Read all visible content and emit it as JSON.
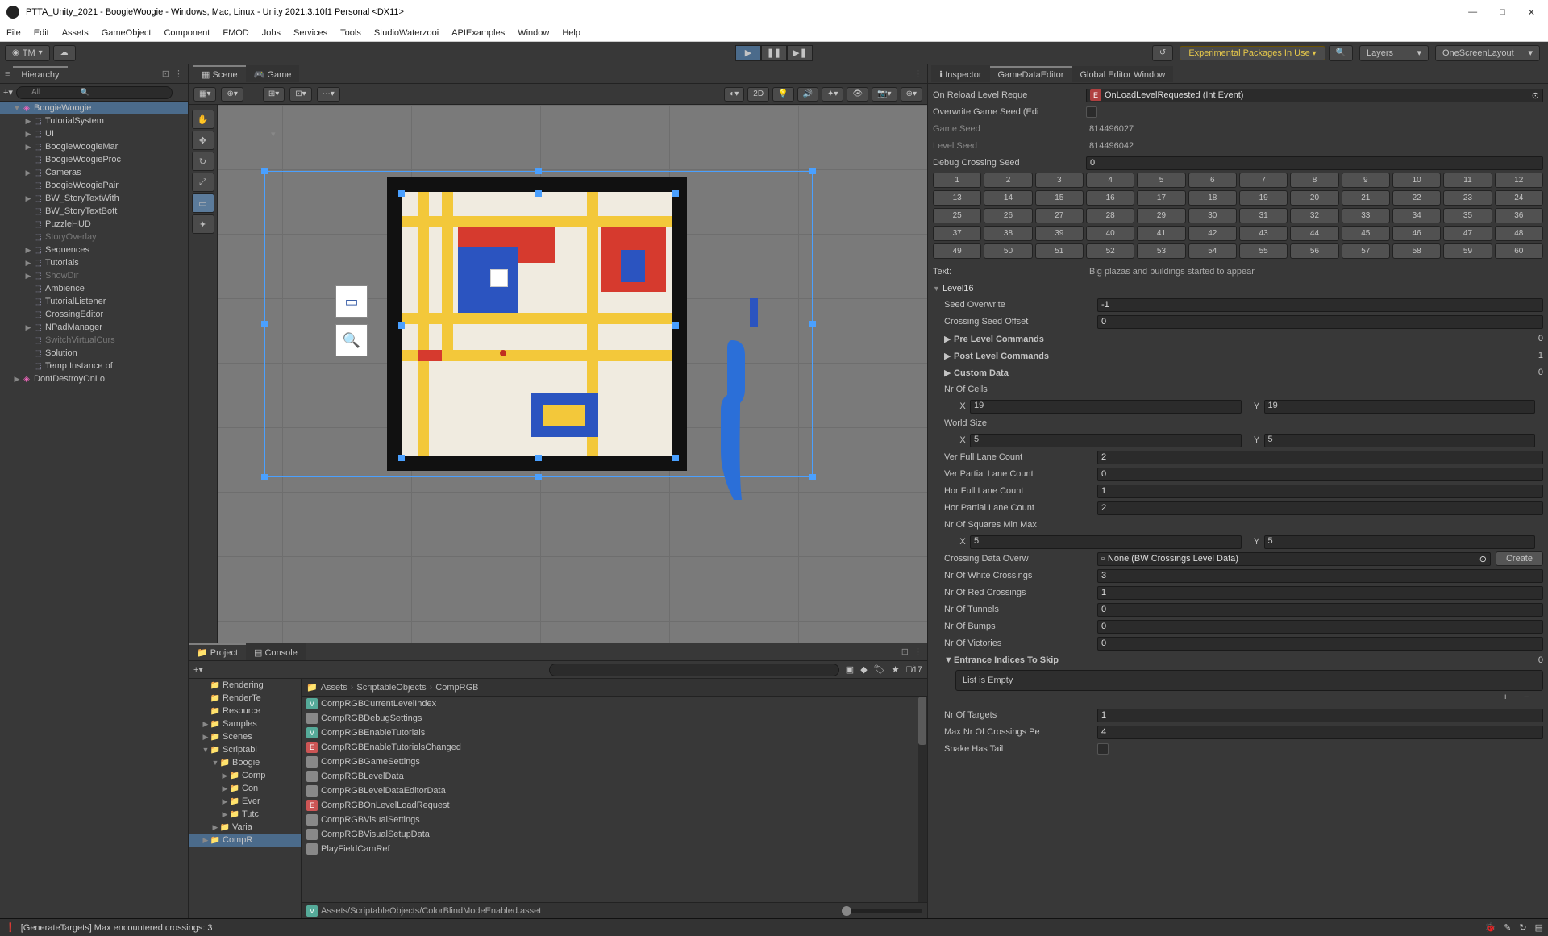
{
  "title": "PTTA_Unity_2021 - BoogieWoogie - Windows, Mac, Linux - Unity 2021.3.10f1 Personal <DX11>",
  "menu": [
    "File",
    "Edit",
    "Assets",
    "GameObject",
    "Component",
    "FMOD",
    "Jobs",
    "Services",
    "Tools",
    "StudioWaterzooi",
    "APIExamples",
    "Window",
    "Help"
  ],
  "toolbar": {
    "account": "TM",
    "warn": "Experimental Packages In Use",
    "layers": "Layers",
    "layout": "OneScreenLayout"
  },
  "tabs": {
    "hierarchy": "Hierarchy",
    "scene": "Scene",
    "game": "Game",
    "project": "Project",
    "console": "Console",
    "inspector": "Inspector",
    "gde": "GameDataEditor",
    "gew": "Global Editor Window"
  },
  "scenebar": {
    "twod": "2D"
  },
  "hierSearch": "All",
  "hierarchy": [
    {
      "d": 0,
      "f": "▼",
      "i": "u",
      "t": "BoogieWoogie",
      "sel": true
    },
    {
      "d": 1,
      "f": "▶",
      "i": "g",
      "t": "TutorialSystem"
    },
    {
      "d": 1,
      "f": "▶",
      "i": "g",
      "t": "UI"
    },
    {
      "d": 1,
      "f": "▶",
      "i": "g",
      "t": "BoogieWoogieMar"
    },
    {
      "d": 1,
      "f": "",
      "i": "g",
      "t": "BoogieWoogieProc"
    },
    {
      "d": 1,
      "f": "▶",
      "i": "g",
      "t": "Cameras"
    },
    {
      "d": 1,
      "f": "",
      "i": "g",
      "t": "BoogieWoogiePair"
    },
    {
      "d": 1,
      "f": "▶",
      "i": "g",
      "t": "BW_StoryTextWith"
    },
    {
      "d": 1,
      "f": "",
      "i": "g",
      "t": "BW_StoryTextBott"
    },
    {
      "d": 1,
      "f": "",
      "i": "g",
      "t": "PuzzleHUD"
    },
    {
      "d": 1,
      "f": "",
      "i": "g",
      "t": "StoryOverlay",
      "dim": true
    },
    {
      "d": 1,
      "f": "▶",
      "i": "g",
      "t": "Sequences"
    },
    {
      "d": 1,
      "f": "▶",
      "i": "g",
      "t": "Tutorials"
    },
    {
      "d": 1,
      "f": "▶",
      "i": "g",
      "t": "ShowDir",
      "dim": true
    },
    {
      "d": 1,
      "f": "",
      "i": "g",
      "t": "Ambience"
    },
    {
      "d": 1,
      "f": "",
      "i": "g",
      "t": "TutorialListener"
    },
    {
      "d": 1,
      "f": "",
      "i": "g",
      "t": "CrossingEditor"
    },
    {
      "d": 1,
      "f": "▶",
      "i": "g",
      "t": "NPadManager"
    },
    {
      "d": 1,
      "f": "",
      "i": "g",
      "t": "SwitchVirtualCurs",
      "dim": true
    },
    {
      "d": 1,
      "f": "",
      "i": "g",
      "t": "Solution"
    },
    {
      "d": 1,
      "f": "",
      "i": "g",
      "t": "Temp Instance of"
    },
    {
      "d": 0,
      "f": "▶",
      "i": "u",
      "t": "DontDestroyOnLo"
    }
  ],
  "projectTree": [
    {
      "d": 1,
      "t": "Rendering"
    },
    {
      "d": 1,
      "t": "RenderTe"
    },
    {
      "d": 1,
      "t": "Resource"
    },
    {
      "d": 1,
      "t": "Samples",
      "f": "▶"
    },
    {
      "d": 1,
      "t": "Scenes",
      "f": "▶"
    },
    {
      "d": 1,
      "t": "Scriptabl",
      "f": "▼"
    },
    {
      "d": 2,
      "t": "Boogie",
      "f": "▼"
    },
    {
      "d": 3,
      "t": "Comp",
      "f": "▶"
    },
    {
      "d": 3,
      "t": "Con",
      "f": "▶"
    },
    {
      "d": 3,
      "t": "Ever",
      "f": "▶"
    },
    {
      "d": 3,
      "t": "Tutc",
      "f": "▶"
    },
    {
      "d": 2,
      "t": "Varia",
      "f": "▶"
    },
    {
      "d": 1,
      "t": "CompR",
      "f": "▶",
      "sel": true
    }
  ],
  "breadcrumb": [
    "Assets",
    "ScriptableObjects",
    "CompRGB"
  ],
  "assets": [
    {
      "c": "#5a9",
      "l": "V",
      "t": "CompRGBCurrentLevelIndex"
    },
    {
      "c": "#888",
      "l": "",
      "t": "CompRGBDebugSettings"
    },
    {
      "c": "#5a9",
      "l": "V",
      "t": "CompRGBEnableTutorials"
    },
    {
      "c": "#c55",
      "l": "E",
      "t": "CompRGBEnableTutorialsChanged"
    },
    {
      "c": "#888",
      "l": "",
      "t": "CompRGBGameSettings"
    },
    {
      "c": "#888",
      "l": "",
      "t": "CompRGBLevelData"
    },
    {
      "c": "#888",
      "l": "",
      "t": "CompRGBLevelDataEditorData"
    },
    {
      "c": "#c55",
      "l": "E",
      "t": "CompRGBOnLevelLoadRequest"
    },
    {
      "c": "#888",
      "l": "",
      "t": "CompRGBVisualSettings"
    },
    {
      "c": "#888",
      "l": "",
      "t": "CompRGBVisualSetupData"
    },
    {
      "c": "#888",
      "l": "",
      "t": "PlayFieldCamRef"
    }
  ],
  "assetPath": "Assets/ScriptableObjects/ColorBlindModeEnabled.asset",
  "assetPathIcon": "V",
  "projCount": "17",
  "inspector": {
    "onReload": {
      "label": "On Reload Level Reque",
      "val": "OnLoadLevelRequested (Int Event)",
      "icon": "E"
    },
    "overwriteSeed": "Overwrite Game Seed (Edi",
    "gameSeed": {
      "label": "Game Seed",
      "val": "814496027"
    },
    "levelSeed": {
      "label": "Level Seed",
      "val": "814496042"
    },
    "debugCrossing": {
      "label": "Debug Crossing Seed",
      "val": "0"
    },
    "numbers": [
      "1",
      "2",
      "3",
      "4",
      "5",
      "6",
      "7",
      "8",
      "9",
      "10",
      "11",
      "12",
      "13",
      "14",
      "15",
      "16",
      "17",
      "18",
      "19",
      "20",
      "21",
      "22",
      "23",
      "24",
      "25",
      "26",
      "27",
      "28",
      "29",
      "30",
      "31",
      "32",
      "33",
      "34",
      "35",
      "36",
      "37",
      "38",
      "39",
      "40",
      "41",
      "42",
      "43",
      "44",
      "45",
      "46",
      "47",
      "48",
      "49",
      "50",
      "51",
      "52",
      "53",
      "54",
      "55",
      "56",
      "57",
      "58",
      "59",
      "60"
    ],
    "text": {
      "label": "Text:",
      "val": "Big plazas and buildings started to appear"
    },
    "level": "Level16",
    "seedOver": {
      "label": "Seed Overwrite",
      "val": "-1"
    },
    "crossOff": {
      "label": "Crossing Seed Offset",
      "val": "0"
    },
    "preLevel": {
      "label": "Pre Level Commands",
      "val": "0"
    },
    "postLevel": {
      "label": "Post Level Commands",
      "val": "1"
    },
    "customData": {
      "label": "Custom Data",
      "val": "0"
    },
    "nrCells": "Nr Of Cells",
    "cellsX": "19",
    "cellsY": "19",
    "worldSize": "World Size",
    "worldX": "5",
    "worldY": "5",
    "verFull": {
      "label": "Ver Full Lane Count",
      "val": "2"
    },
    "verPart": {
      "label": "Ver Partial Lane Count",
      "val": "0"
    },
    "horFull": {
      "label": "Hor Full Lane Count",
      "val": "1"
    },
    "horPart": {
      "label": "Hor Partial Lane Count",
      "val": "2"
    },
    "sqMinMax": "Nr Of Squares Min Max",
    "sqX": "5",
    "sqY": "5",
    "crossData": {
      "label": "Crossing Data Overw",
      "val": "None (BW Crossings Level Data)"
    },
    "create": "Create",
    "nrWhite": {
      "label": "Nr Of White Crossings",
      "val": "3"
    },
    "nrRed": {
      "label": "Nr Of Red Crossings",
      "val": "1"
    },
    "nrTun": {
      "label": "Nr Of Tunnels",
      "val": "0"
    },
    "nrBump": {
      "label": "Nr Of Bumps",
      "val": "0"
    },
    "nrVic": {
      "label": "Nr Of Victories",
      "val": "0"
    },
    "entSkip": {
      "label": "Entrance Indices To Skip",
      "val": "0"
    },
    "listEmpty": "List is Empty",
    "nrTarg": {
      "label": "Nr Of Targets",
      "val": "1"
    },
    "maxCross": {
      "label": "Max Nr Of Crossings Pe",
      "val": "4"
    },
    "snake": "Snake Has Tail"
  },
  "status": "[GenerateTargets] Max encountered crossings: 3"
}
